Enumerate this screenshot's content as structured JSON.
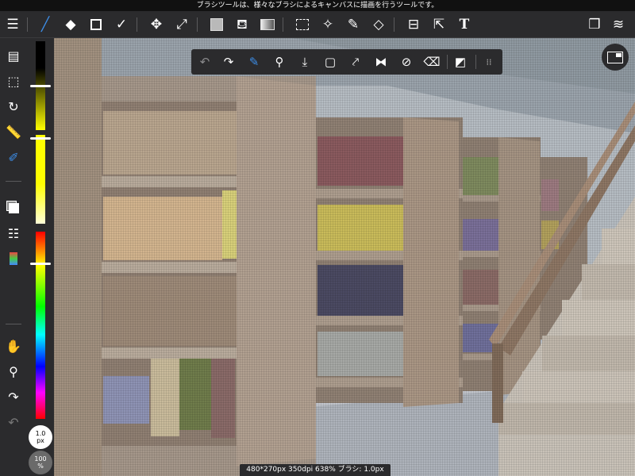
{
  "status_bar": {
    "hint": "ブラシツールは、様々なブラシによるキャンバスに描画を行うツールです。"
  },
  "top_toolbar": {
    "items": [
      {
        "icon": "menu-icon",
        "glyph": "☰"
      },
      {
        "icon": "brush-icon",
        "glyph": "╱"
      },
      {
        "icon": "eraser-icon",
        "glyph": "◆"
      },
      {
        "icon": "shape-icon",
        "glyph": ""
      },
      {
        "icon": "correction-icon",
        "glyph": "✓"
      },
      {
        "icon": "move-icon",
        "glyph": "✥"
      },
      {
        "icon": "transform-icon",
        "glyph": "⤢"
      },
      {
        "icon": "fill-color-icon",
        "glyph": ""
      },
      {
        "icon": "bucket-icon",
        "glyph": "⛾"
      },
      {
        "icon": "gradation-icon",
        "glyph": ""
      },
      {
        "icon": "select-rect-icon",
        "glyph": ""
      },
      {
        "icon": "magic-wand-icon",
        "glyph": "✧"
      },
      {
        "icon": "select-pen-icon",
        "glyph": "✎"
      },
      {
        "icon": "select-eraser-icon",
        "glyph": "◇"
      },
      {
        "icon": "divide-icon",
        "glyph": "⊟"
      },
      {
        "icon": "operation-icon",
        "glyph": "⇱"
      },
      {
        "icon": "text-icon",
        "glyph": "T"
      },
      {
        "icon": "material-icon",
        "glyph": "❒"
      },
      {
        "icon": "layers-icon",
        "glyph": "≋"
      }
    ]
  },
  "left_toolbar": {
    "items": [
      {
        "icon": "document-icon",
        "glyph": "▤"
      },
      {
        "icon": "select-icon",
        "glyph": "⬚"
      },
      {
        "icon": "rotate-icon",
        "glyph": "↻"
      },
      {
        "icon": "ruler-icon",
        "glyph": "📏"
      },
      {
        "icon": "snap-icon",
        "glyph": "✐"
      },
      {
        "icon": "layer-switch-icon",
        "glyph": ""
      },
      {
        "icon": "layer-list-icon",
        "glyph": "☷"
      },
      {
        "icon": "rgb-icon",
        "glyph": ""
      },
      {
        "icon": "hand-icon",
        "glyph": "✋"
      },
      {
        "icon": "eyedropper-icon",
        "glyph": "⚲"
      },
      {
        "icon": "redo-icon",
        "glyph": "↷"
      },
      {
        "icon": "undo-icon",
        "glyph": "↶"
      }
    ]
  },
  "brush": {
    "size_value": "1.0",
    "size_unit": "px",
    "opacity_value": "100",
    "opacity_unit": "%"
  },
  "color_sliders": {
    "dark_level": 0.5,
    "light_level": 0.04,
    "hue_level": 0.17
  },
  "quick_bar": {
    "items": [
      {
        "icon": "undo-icon",
        "glyph": "↶"
      },
      {
        "icon": "redo-icon",
        "glyph": "↷"
      },
      {
        "icon": "brush-icon",
        "glyph": "✎"
      },
      {
        "icon": "eyedropper-icon",
        "glyph": "⚲"
      },
      {
        "icon": "import-icon",
        "glyph": "⤓"
      },
      {
        "icon": "frame-icon",
        "glyph": "▢"
      },
      {
        "icon": "export-icon",
        "glyph": "⤤"
      },
      {
        "icon": "flip-icon",
        "glyph": "⧓"
      },
      {
        "icon": "no-rotate-icon",
        "glyph": "⊘"
      },
      {
        "icon": "clear-icon",
        "glyph": "⌫"
      },
      {
        "icon": "fullscreen-icon",
        "glyph": "◩"
      },
      {
        "icon": "grid-dots-icon",
        "glyph": "⁞⁞"
      }
    ]
  },
  "info_bar": {
    "text": "480*270px 350dpi 638% ブラシ: 1.0px 100%"
  }
}
